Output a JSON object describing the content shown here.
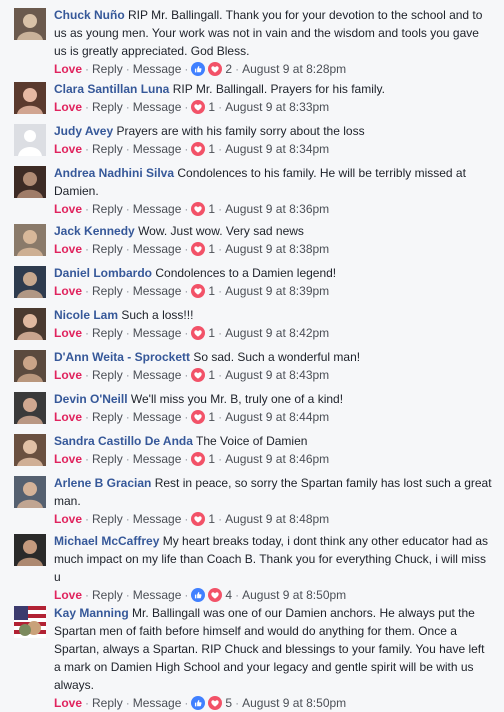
{
  "actions": {
    "love": "Love",
    "reply": "Reply",
    "message": "Message",
    "separator": "·"
  },
  "colors": {
    "name": "#365899",
    "love": "#e0245e",
    "like_blue": "#4080ff",
    "heart_red": "#f25268",
    "background": "#f6f7f9"
  },
  "comments": [
    {
      "name": "Chuck Nuño",
      "text": "RIP Mr. Ballingall. Thank you for your devotion to the school and to us as young men. Your work was not in vain and the wisdom and tools you gave us is greatly appreciated. God Bless.",
      "reaction_icons": [
        "like-icon",
        "heart-icon"
      ],
      "reaction_count": "2",
      "timestamp": "August 9 at 8:28pm"
    },
    {
      "name": "Clara Santillan Luna",
      "text": "RIP Mr. Ballingall. Prayers for his family.",
      "reaction_icons": [
        "heart-icon"
      ],
      "reaction_count": "1",
      "timestamp": "August 9 at 8:33pm"
    },
    {
      "name": "Judy Avey",
      "text": "Prayers are with his family sorry about the loss",
      "reaction_icons": [
        "heart-icon"
      ],
      "reaction_count": "1",
      "timestamp": "August 9 at 8:34pm"
    },
    {
      "name": "Andrea Nadhini Silva",
      "text": "Condolences to his family. He will be terribly missed at Damien.",
      "reaction_icons": [
        "heart-icon"
      ],
      "reaction_count": "1",
      "timestamp": "August 9 at 8:36pm"
    },
    {
      "name": "Jack Kennedy",
      "text": "Wow. Just wow. Very sad news",
      "reaction_icons": [
        "heart-icon"
      ],
      "reaction_count": "1",
      "timestamp": "August 9 at 8:38pm"
    },
    {
      "name": "Daniel Lombardo",
      "text": "Condolences to a Damien legend!",
      "reaction_icons": [
        "heart-icon"
      ],
      "reaction_count": "1",
      "timestamp": "August 9 at 8:39pm"
    },
    {
      "name": "Nicole Lam",
      "text": "Such a loss!!!",
      "reaction_icons": [
        "heart-icon"
      ],
      "reaction_count": "1",
      "timestamp": "August 9 at 8:42pm"
    },
    {
      "name": "D'Ann Weita - Sprockett",
      "text": "So sad. Such a wonderful man!",
      "reaction_icons": [
        "heart-icon"
      ],
      "reaction_count": "1",
      "timestamp": "August 9 at 8:43pm"
    },
    {
      "name": "Devin O'Neill",
      "text": "We'll miss you Mr. B, truly one of a kind!",
      "reaction_icons": [
        "heart-icon"
      ],
      "reaction_count": "1",
      "timestamp": "August 9 at 8:44pm"
    },
    {
      "name": "Sandra Castillo De Anda",
      "text": "The Voice of Damien",
      "reaction_icons": [
        "heart-icon"
      ],
      "reaction_count": "1",
      "timestamp": "August 9 at 8:46pm"
    },
    {
      "name": "Arlene B Gracian",
      "text": "Rest in peace, so sorry the Spartan family has lost such a great man.",
      "reaction_icons": [
        "heart-icon"
      ],
      "reaction_count": "1",
      "timestamp": "August 9 at 8:48pm"
    },
    {
      "name": "Michael McCaffrey",
      "text": "My heart breaks today, i dont think any other educator had as much impact on my life than Coach B. Thank you for everything Chuck, i will miss u",
      "reaction_icons": [
        "like-icon",
        "heart-icon"
      ],
      "reaction_count": "4",
      "timestamp": "August 9 at 8:50pm"
    },
    {
      "name": "Kay Manning",
      "text": "Mr. Ballingall was one of our Damien anchors. He always put the Spartan men of faith before himself and would do anything for them. Once a Spartan, always a Spartan. RIP Chuck and blessings to your family. You have left a mark on Damien High School and your legacy and gentle spirit will be with us always.",
      "reaction_icons": [
        "like-icon",
        "heart-icon"
      ],
      "reaction_count": "5",
      "timestamp": "August 9 at 8:50pm"
    }
  ]
}
